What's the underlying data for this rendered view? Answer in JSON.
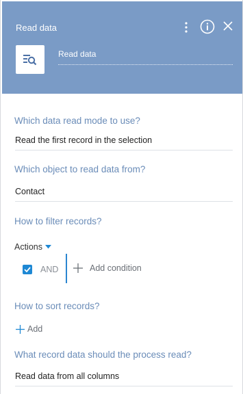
{
  "header": {
    "title": "Read data",
    "element_name": "Read data",
    "menu_icon": "more-vertical-icon",
    "info_icon": "info-icon",
    "close_icon": "close-icon",
    "element_icon": "read-data-icon",
    "background_color": "#7a9bc6"
  },
  "sections": {
    "read_mode": {
      "label": "Which data read mode to use?",
      "value": "Read the first record in the selection"
    },
    "object": {
      "label": "Which object to read data from?",
      "value": "Contact"
    },
    "filter": {
      "label": "How to filter records?",
      "actions_label": "Actions",
      "group_operator": "AND",
      "group_checked": true,
      "add_condition_label": "Add condition"
    },
    "sort": {
      "label": "How to sort records?",
      "add_label": "Add"
    },
    "columns": {
      "label": "What record data should the process read?",
      "value": "Read data from all columns"
    }
  },
  "colors": {
    "section_label": "#6a8cb8",
    "accent": "#1e88d4"
  }
}
